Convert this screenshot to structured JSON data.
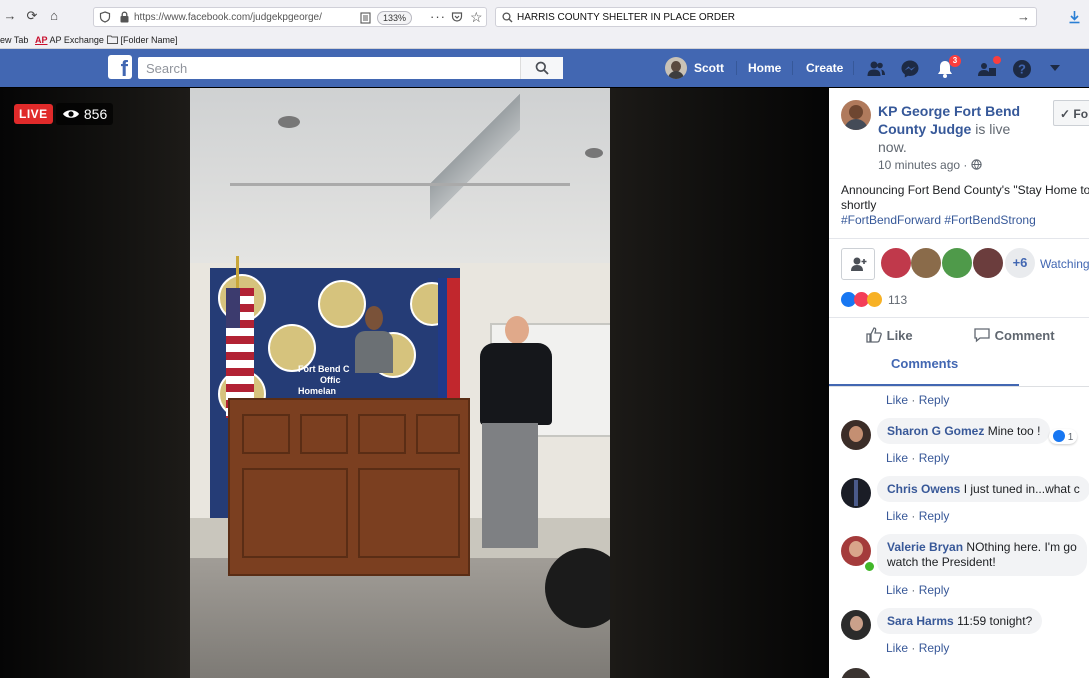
{
  "browser": {
    "tab_stub": "ew Tab",
    "url": "https://www.facebook.com/judgekpgeorge/",
    "zoom": "133%",
    "search_query": "HARRIS COUNTY SHELTER IN PLACE ORDER",
    "bookmarks": [
      {
        "badge": "AP",
        "label": "AP Exchange"
      },
      {
        "label": "[Folder Name]"
      }
    ]
  },
  "facebook": {
    "search_placeholder": "Search",
    "user_name": "Scott",
    "nav_home": "Home",
    "nav_create": "Create",
    "notifications_count": "3",
    "brand_color": "#4267b2"
  },
  "video": {
    "live_label": "LIVE",
    "viewer_count": "856",
    "backdrop_text": [
      "Fort Bend C",
      "Offic",
      "Homelan"
    ]
  },
  "post": {
    "author": "KP George Fort Bend County Judge",
    "author_line1": "KP George Fort Bend",
    "author_line2_name": "County Judge",
    "author_status": " is live",
    "author_status2": "now.",
    "follow_label": "Fo",
    "timestamp": "10 minutes ago ·",
    "text_line1": "Announcing Fort Bend County's \"Stay Home to",
    "text_line2": "shortly",
    "hashtags": "#FortBendForward #FortBendStrong",
    "watchers_more": "+6",
    "watching_label": "Watching",
    "reaction_count": "113",
    "like_label": "Like",
    "comment_label": "Comment",
    "comments_tab": "Comments"
  },
  "comments": {
    "like": "Like",
    "reply": "Reply",
    "items": [
      {
        "name": "Sharon G Gomez",
        "text": "Mine too !",
        "likes": "1"
      },
      {
        "name": "Chris Owens",
        "text": "I just tuned in...what c"
      },
      {
        "name": "Valerie Bryan",
        "text": "NOthing here. I'm go",
        "text2": "watch the President!"
      },
      {
        "name": "Sara Harms",
        "text": "11:59 tonight?"
      }
    ]
  }
}
